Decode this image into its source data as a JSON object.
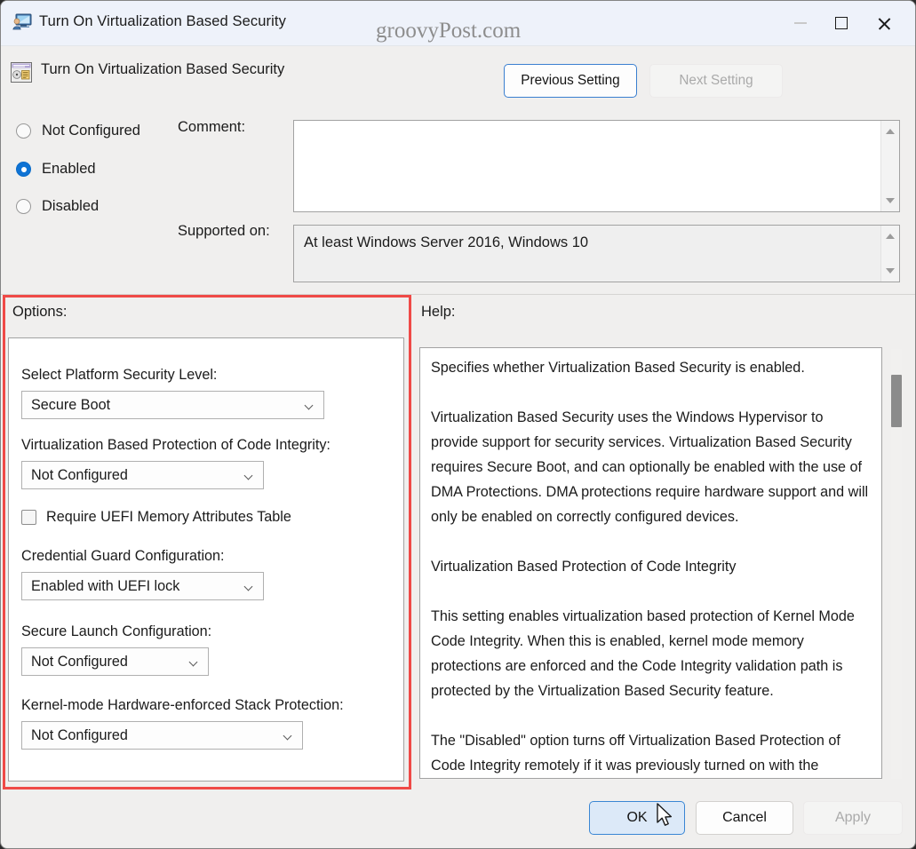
{
  "window": {
    "title": "Turn On Virtualization Based Security",
    "icon": "monitor-user-icon",
    "watermark": "groovyPost.com",
    "caption_buttons": {
      "minimize": "minimize-icon",
      "maximize": "maximize-icon",
      "close": "close-icon"
    }
  },
  "header": {
    "icon": "policy-setting-icon",
    "title": "Turn On Virtualization Based Security",
    "previous_setting_label": "Previous Setting",
    "next_setting_label": "Next Setting",
    "next_setting_disabled": true
  },
  "state": {
    "radios": [
      {
        "label": "Not Configured",
        "checked": false
      },
      {
        "label": "Enabled",
        "checked": true
      },
      {
        "label": "Disabled",
        "checked": false
      }
    ]
  },
  "comment": {
    "label": "Comment:",
    "value": "",
    "placeholder": ""
  },
  "supported_on": {
    "label": "Supported on:",
    "value": "At least Windows Server 2016, Windows 10"
  },
  "options": {
    "section_label": "Options:",
    "controls": [
      {
        "type": "combo",
        "label": "Select Platform Security Level:",
        "value": "Secure Boot"
      },
      {
        "type": "combo",
        "label": "Virtualization Based Protection of Code Integrity:",
        "value": "Not Configured"
      },
      {
        "type": "checkbox",
        "label": "Require UEFI Memory Attributes Table",
        "checked": false
      },
      {
        "type": "combo",
        "label": "Credential Guard Configuration:",
        "value": "Enabled with UEFI lock"
      },
      {
        "type": "combo",
        "label": "Secure Launch Configuration:",
        "value": "Not Configured"
      },
      {
        "type": "combo",
        "label": "Kernel-mode Hardware-enforced Stack Protection:",
        "value": "Not Configured"
      }
    ]
  },
  "help": {
    "section_label": "Help:",
    "text": "Specifies whether Virtualization Based Security is enabled.\n\nVirtualization Based Security uses the Windows Hypervisor to provide support for security services. Virtualization Based Security requires Secure Boot, and can optionally be enabled with the use of DMA Protections. DMA protections require hardware support and will only be enabled on correctly configured devices.\n\nVirtualization Based Protection of Code Integrity\n\nThis setting enables virtualization based protection of Kernel Mode Code Integrity. When this is enabled, kernel mode memory protections are enforced and the Code Integrity validation path is protected by the Virtualization Based Security feature.\n\nThe \"Disabled\" option turns off Virtualization Based Protection of Code Integrity remotely if it was previously turned on with the \"Enabled without lock\" option.\n\nThe \"Enabled with UEFI lock\" option ensures that Virtualization"
  },
  "footer": {
    "ok_label": "OK",
    "cancel_label": "Cancel",
    "apply_label": "Apply",
    "apply_disabled": true
  },
  "annotation": {
    "color": "#ef4a47",
    "target": "options-panel"
  },
  "cursor": {
    "icon": "arrow-pointer-icon"
  }
}
